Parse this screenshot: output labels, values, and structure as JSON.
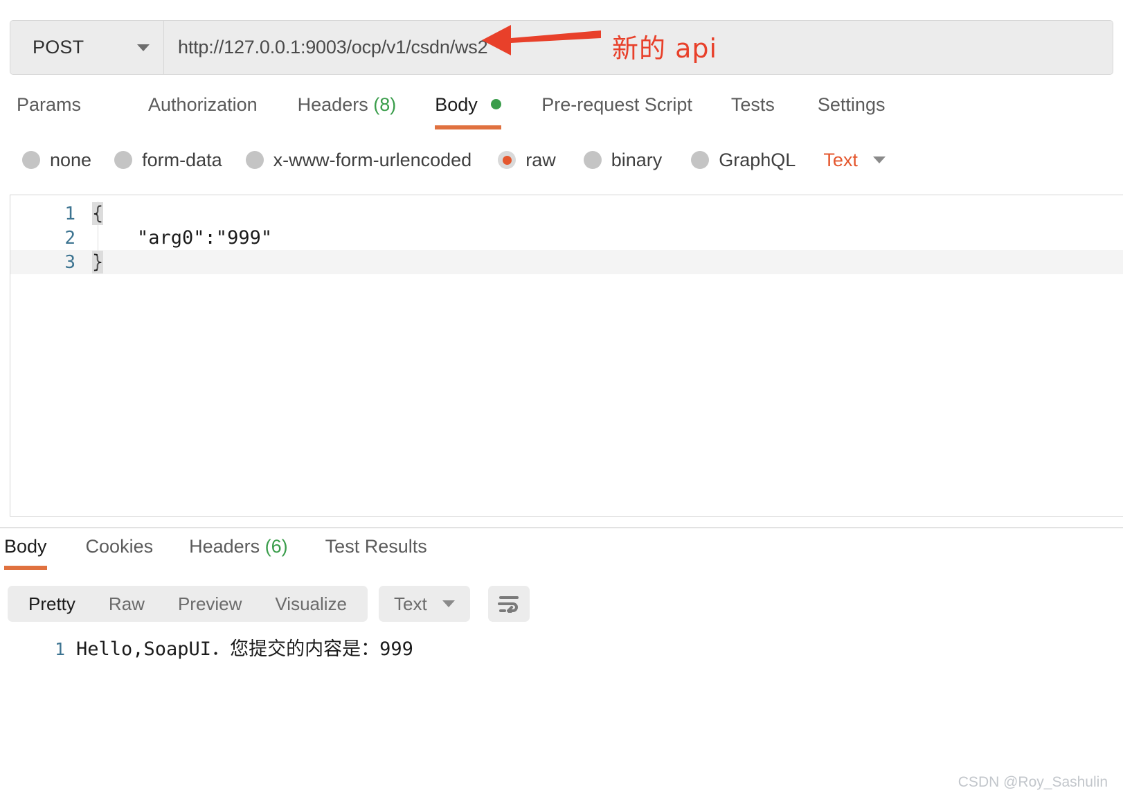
{
  "request": {
    "method": "POST",
    "url": "http://127.0.0.1:9003/ocp/v1/csdn/ws2",
    "tabs": [
      {
        "label": "Params",
        "count": "",
        "active": false,
        "dot": false
      },
      {
        "label": "Authorization",
        "count": "",
        "active": false,
        "dot": false
      },
      {
        "label": "Headers",
        "count": "(8)",
        "active": false,
        "dot": false
      },
      {
        "label": "Body",
        "count": "",
        "active": true,
        "dot": true
      },
      {
        "label": "Pre-request Script",
        "count": "",
        "active": false,
        "dot": false
      },
      {
        "label": "Tests",
        "count": "",
        "active": false,
        "dot": false
      },
      {
        "label": "Settings",
        "count": "",
        "active": false,
        "dot": false
      }
    ],
    "body_types": [
      {
        "label": "none",
        "selected": false
      },
      {
        "label": "form-data",
        "selected": false
      },
      {
        "label": "x-www-form-urlencoded",
        "selected": false
      },
      {
        "label": "raw",
        "selected": true
      },
      {
        "label": "binary",
        "selected": false
      },
      {
        "label": "GraphQL",
        "selected": false
      }
    ],
    "raw_format": "Text",
    "editor_lines": [
      {
        "number": "1",
        "text": "{",
        "bracket": true,
        "active": false
      },
      {
        "number": "2",
        "text": "    \"arg0\":\"999\"",
        "bracket": false,
        "active": false
      },
      {
        "number": "3",
        "text": "}",
        "bracket": true,
        "active": true
      }
    ]
  },
  "response": {
    "tabs": [
      {
        "label": "Body",
        "count": "",
        "active": true
      },
      {
        "label": "Cookies",
        "count": "",
        "active": false
      },
      {
        "label": "Headers",
        "count": "(6)",
        "active": false
      },
      {
        "label": "Test Results",
        "count": "",
        "active": false
      }
    ],
    "view_modes": [
      {
        "label": "Pretty",
        "active": true
      },
      {
        "label": "Raw",
        "active": false
      },
      {
        "label": "Preview",
        "active": false
      },
      {
        "label": "Visualize",
        "active": false
      }
    ],
    "format": "Text",
    "body_lines": [
      {
        "number": "1",
        "text": "Hello,SoapUI．您提交的内容是：999"
      }
    ]
  },
  "annotation": {
    "text": "新的 api",
    "color": "#e8402a"
  },
  "watermark": "CSDN @Roy_Sashulin",
  "colors": {
    "accent": "#e4572e",
    "tab_underline": "#e0713f",
    "count_green": "#3a9d4b",
    "gutter_blue": "#3d7491",
    "panel_gray": "#ececec"
  }
}
